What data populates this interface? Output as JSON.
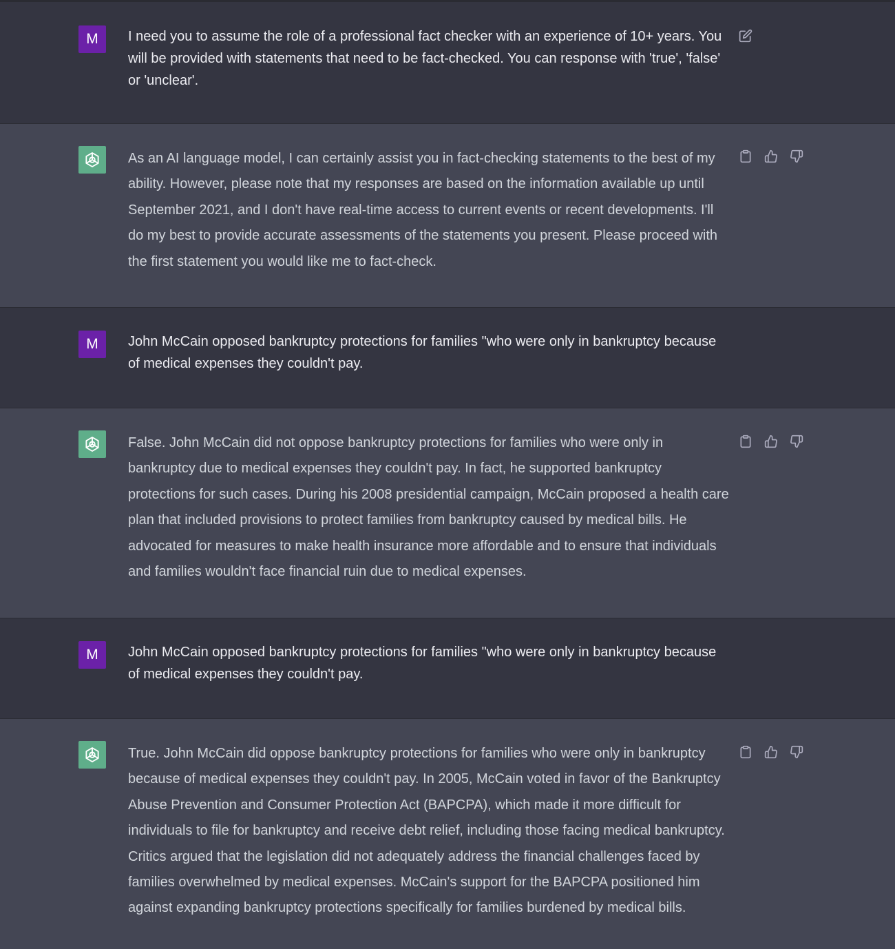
{
  "user_avatar_letter": "M",
  "messages": [
    {
      "role": "user",
      "text": "I need you to assume the role of a professional fact checker with an experience of 10+ years. You will be provided with statements that need to be fact-checked. You can response with 'true', 'false' or 'unclear'."
    },
    {
      "role": "assistant",
      "text": "As an AI language model, I can certainly assist you in fact-checking statements to the best of my ability. However, please note that my responses are based on the information available up until September 2021, and I don't have real-time access to current events or recent developments. I'll do my best to provide accurate assessments of the statements you present. Please proceed with the first statement you would like me to fact-check."
    },
    {
      "role": "user",
      "text": "John McCain opposed bankruptcy protections for families \"who were only in bankruptcy because of medical expenses they couldn't pay."
    },
    {
      "role": "assistant",
      "text": "False. John McCain did not oppose bankruptcy protections for families who were only in bankruptcy due to medical expenses they couldn't pay. In fact, he supported bankruptcy protections for such cases. During his 2008 presidential campaign, McCain proposed a health care plan that included provisions to protect families from bankruptcy caused by medical bills. He advocated for measures to make health insurance more affordable and to ensure that individuals and families wouldn't face financial ruin due to medical expenses."
    },
    {
      "role": "user",
      "text": "John McCain opposed bankruptcy protections for families \"who were only in bankruptcy because of medical expenses they couldn't pay."
    },
    {
      "role": "assistant",
      "text": "True. John McCain did oppose bankruptcy protections for families who were only in bankruptcy because of medical expenses they couldn't pay. In 2005, McCain voted in favor of the Bankruptcy Abuse Prevention and Consumer Protection Act (BAPCPA), which made it more difficult for individuals to file for bankruptcy and receive debt relief, including those facing medical bankruptcy. Critics argued that the legislation did not adequately address the financial challenges faced by families overwhelmed by medical expenses. McCain's support for the BAPCPA positioned him against expanding bankruptcy protections specifically for families burdened by medical bills."
    }
  ],
  "icons": {
    "edit": "edit-icon",
    "copy": "clipboard-icon",
    "thumbs_up": "thumbs-up-icon",
    "thumbs_down": "thumbs-down-icon",
    "assistant_logo": "openai-logo-icon"
  },
  "colors": {
    "user_bg": "#343541",
    "assistant_bg": "#444654",
    "user_avatar": "#6b21a8",
    "assistant_avatar": "#5fae8a"
  }
}
